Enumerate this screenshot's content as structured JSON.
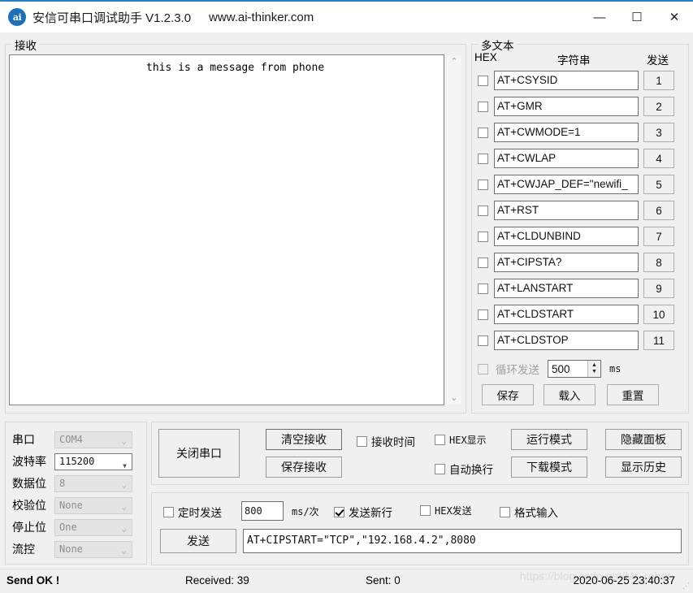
{
  "window": {
    "icon_label": "ai",
    "title": "安信可串口调试助手 V1.2.3.0",
    "url": "www.ai-thinker.com",
    "minimize": "—",
    "maximize": "☐",
    "close": "✕"
  },
  "receive": {
    "legend": "接收",
    "content": "this is a message from phone",
    "scroll_up": "⌃",
    "scroll_down": "⌄"
  },
  "multitext": {
    "legend": "多文本",
    "col_hex": "HEX",
    "col_string": "字符串",
    "col_send": "发送",
    "rows": [
      {
        "checked": false,
        "command": "AT+CSYSID",
        "button": "1"
      },
      {
        "checked": false,
        "command": "AT+GMR",
        "button": "2"
      },
      {
        "checked": false,
        "command": "AT+CWMODE=1",
        "button": "3"
      },
      {
        "checked": false,
        "command": "AT+CWLAP",
        "button": "4"
      },
      {
        "checked": false,
        "command": "AT+CWJAP_DEF=\"newifi_",
        "button": "5"
      },
      {
        "checked": false,
        "command": "AT+RST",
        "button": "6"
      },
      {
        "checked": false,
        "command": "AT+CLDUNBIND",
        "button": "7"
      },
      {
        "checked": false,
        "command": "AT+CIPSTA?",
        "button": "8"
      },
      {
        "checked": false,
        "command": "AT+LANSTART",
        "button": "9"
      },
      {
        "checked": false,
        "command": "AT+CLDSTART",
        "button": "10"
      },
      {
        "checked": false,
        "command": "AT+CLDSTOP",
        "button": "11"
      }
    ],
    "loop_send_label": "循环发送",
    "loop_send_checked": false,
    "loop_interval": "500",
    "loop_unit": "ms",
    "save_label": "保存",
    "load_label": "载入",
    "reset_label": "重置"
  },
  "serial": {
    "fields": [
      {
        "label": "串口",
        "value": "COM4",
        "enabled": false
      },
      {
        "label": "波特率",
        "value": "115200",
        "enabled": true
      },
      {
        "label": "数据位",
        "value": "8",
        "enabled": false
      },
      {
        "label": "校验位",
        "value": "None",
        "enabled": false
      },
      {
        "label": "停止位",
        "value": "One",
        "enabled": false
      },
      {
        "label": "流控",
        "value": "None",
        "enabled": false
      }
    ]
  },
  "controls": {
    "close_port": "关闭串口",
    "clear_recv": "清空接收",
    "save_recv": "保存接收",
    "recv_time_label": "接收时间",
    "recv_time_checked": false,
    "hex_show_label": "HEX显示",
    "hex_show_checked": false,
    "auto_wrap_label": "自动换行",
    "auto_wrap_checked": false,
    "run_mode": "运行模式",
    "download_mode": "下载模式",
    "hide_panel": "隐藏面板",
    "show_history": "显示历史"
  },
  "send": {
    "timer_label": "定时发送",
    "timer_checked": false,
    "timer_value": "800",
    "timer_unit": "ms/次",
    "newline_label": "发送新行",
    "newline_checked": true,
    "hex_send_label": "HEX发送",
    "hex_send_checked": false,
    "format_input_label": "格式输入",
    "format_input_checked": false,
    "send_button": "发送",
    "command": "AT+CIPSTART=\"TCP\",\"192.168.4.2\",8080"
  },
  "status": {
    "send_state": "Send OK !",
    "received": "Received: 39",
    "sent": "Sent: 0",
    "timestamp": "2020-06-25 23:40:37",
    "watermark": "https://blog.csdn.net/Mr_robot",
    "grip": "⋰"
  }
}
